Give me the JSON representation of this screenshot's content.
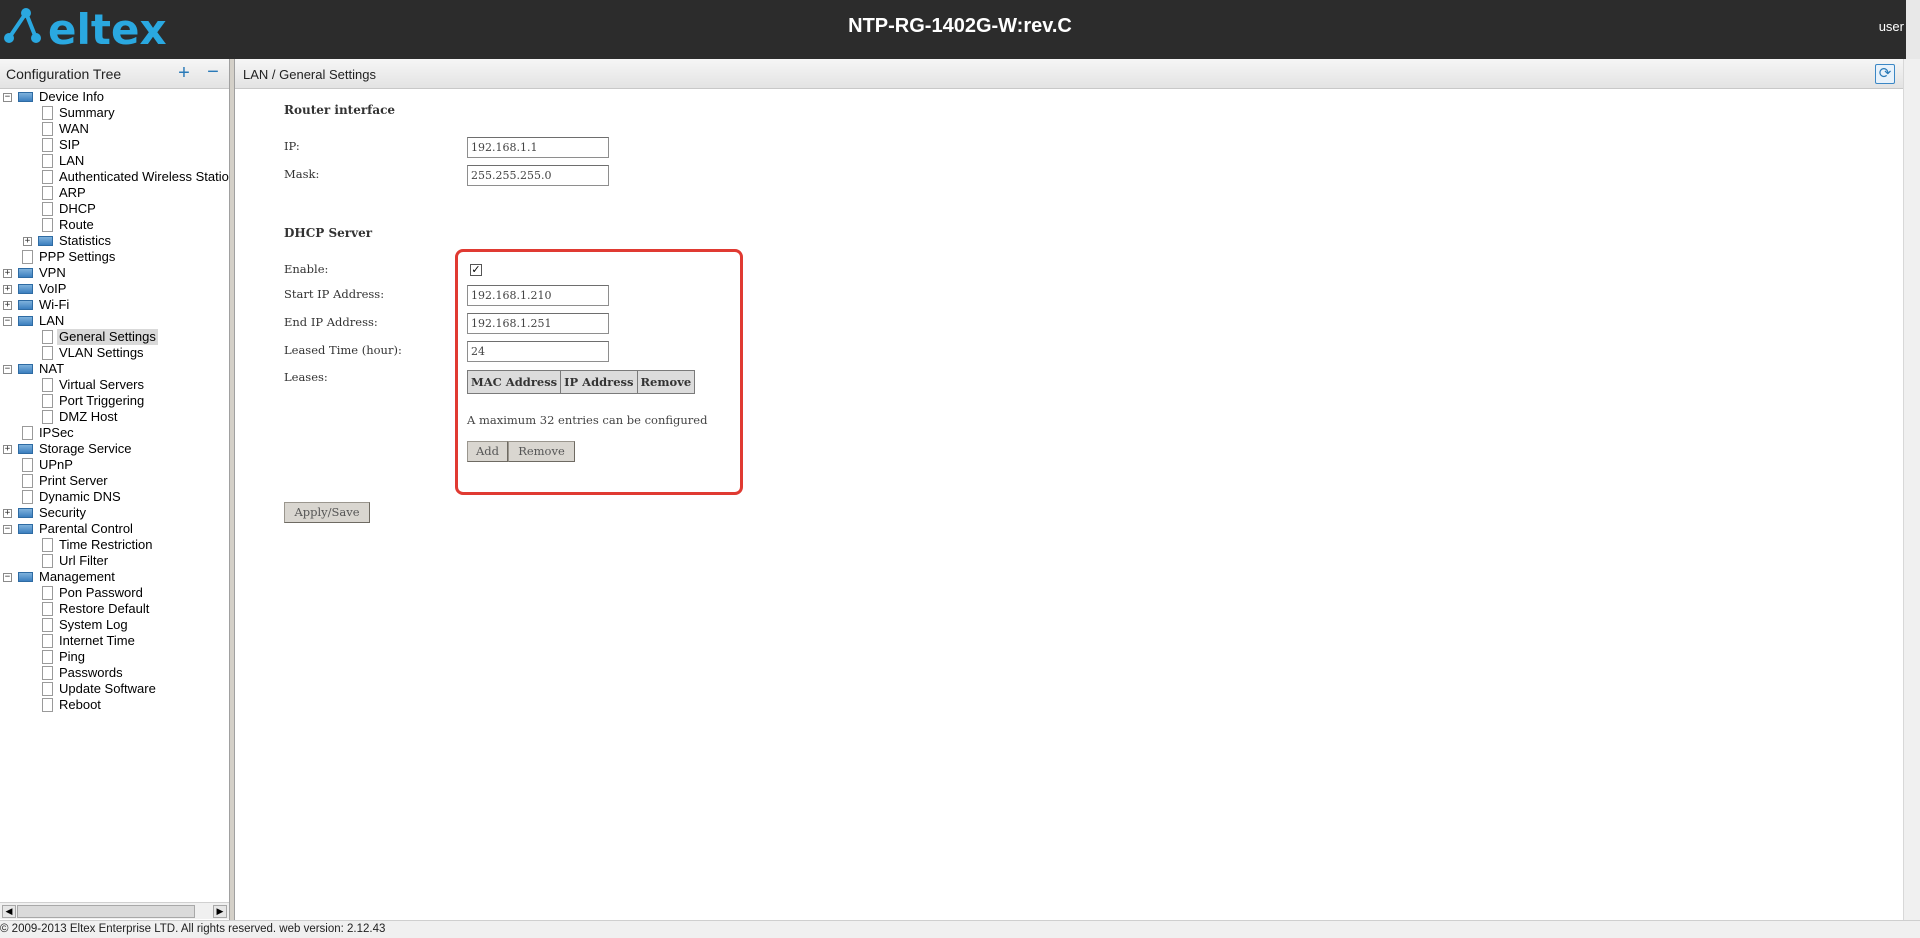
{
  "header": {
    "logo_text": "eltex",
    "device_title": "NTP-RG-1402G-W:rev.C",
    "user": "user"
  },
  "sidebar": {
    "title": "Configuration Tree",
    "tree": [
      {
        "label": "Device Info",
        "level": 0,
        "type": "folder",
        "toggle": "-"
      },
      {
        "label": "Summary",
        "level": 1,
        "type": "page"
      },
      {
        "label": "WAN",
        "level": 1,
        "type": "page"
      },
      {
        "label": "SIP",
        "level": 1,
        "type": "page"
      },
      {
        "label": "LAN",
        "level": 1,
        "type": "page"
      },
      {
        "label": "Authenticated Wireless Statio",
        "level": 1,
        "type": "page"
      },
      {
        "label": "ARP",
        "level": 1,
        "type": "page"
      },
      {
        "label": "DHCP",
        "level": 1,
        "type": "page"
      },
      {
        "label": "Route",
        "level": 1,
        "type": "page"
      },
      {
        "label": "Statistics",
        "level": 1,
        "type": "folder",
        "toggle": "+"
      },
      {
        "label": "PPP Settings",
        "level": 0,
        "type": "page"
      },
      {
        "label": "VPN",
        "level": 0,
        "type": "folder",
        "toggle": "+"
      },
      {
        "label": "VoIP",
        "level": 0,
        "type": "folder",
        "toggle": "+"
      },
      {
        "label": "Wi-Fi",
        "level": 0,
        "type": "folder",
        "toggle": "+"
      },
      {
        "label": "LAN",
        "level": 0,
        "type": "folder",
        "toggle": "-"
      },
      {
        "label": "General Settings",
        "level": 1,
        "type": "page",
        "selected": true
      },
      {
        "label": "VLAN Settings",
        "level": 1,
        "type": "page"
      },
      {
        "label": "NAT",
        "level": 0,
        "type": "folder",
        "toggle": "-"
      },
      {
        "label": "Virtual Servers",
        "level": 1,
        "type": "page"
      },
      {
        "label": "Port Triggering",
        "level": 1,
        "type": "page"
      },
      {
        "label": "DMZ Host",
        "level": 1,
        "type": "page"
      },
      {
        "label": "IPSec",
        "level": 0,
        "type": "page"
      },
      {
        "label": "Storage Service",
        "level": 0,
        "type": "folder",
        "toggle": "+"
      },
      {
        "label": "UPnP",
        "level": 0,
        "type": "page"
      },
      {
        "label": "Print Server",
        "level": 0,
        "type": "page"
      },
      {
        "label": "Dynamic DNS",
        "level": 0,
        "type": "page"
      },
      {
        "label": "Security",
        "level": 0,
        "type": "folder",
        "toggle": "+"
      },
      {
        "label": "Parental Control",
        "level": 0,
        "type": "folder",
        "toggle": "-"
      },
      {
        "label": "Time Restriction",
        "level": 1,
        "type": "page"
      },
      {
        "label": "Url Filter",
        "level": 1,
        "type": "page"
      },
      {
        "label": "Management",
        "level": 0,
        "type": "folder",
        "toggle": "-"
      },
      {
        "label": "Pon Password",
        "level": 1,
        "type": "page"
      },
      {
        "label": "Restore Default",
        "level": 1,
        "type": "page"
      },
      {
        "label": "System Log",
        "level": 1,
        "type": "page"
      },
      {
        "label": "Internet Time",
        "level": 1,
        "type": "page"
      },
      {
        "label": "Ping",
        "level": 1,
        "type": "page"
      },
      {
        "label": "Passwords",
        "level": 1,
        "type": "page"
      },
      {
        "label": "Update Software",
        "level": 1,
        "type": "page"
      },
      {
        "label": "Reboot",
        "level": 1,
        "type": "page"
      }
    ]
  },
  "main": {
    "breadcrumb": "LAN / General Settings",
    "router_interface": {
      "title": "Router interface",
      "ip_label": "IP:",
      "ip_value": "192.168.1.1",
      "mask_label": "Mask:",
      "mask_value": "255.255.255.0"
    },
    "dhcp": {
      "title": "DHCP Server",
      "enable_label": "Enable:",
      "enable_checked": true,
      "start_label": "Start IP Address:",
      "start_value": "192.168.1.210",
      "end_label": "End IP Address:",
      "end_value": "192.168.1.251",
      "lease_label": "Leased Time (hour):",
      "lease_value": "24",
      "leases_label": "Leases:",
      "leases_columns": [
        "MAC Address",
        "IP Address",
        "Remove"
      ],
      "note": "A maximum 32 entries can be configured",
      "add_label": "Add",
      "remove_label": "Remove"
    },
    "apply_label": "Apply/Save"
  },
  "footer": {
    "text": "© 2009-2013 Eltex Enterprise LTD. All rights reserved. web version: 2.12.43"
  },
  "colors": {
    "header_bg": "#2c2c2c",
    "logo": "#2aa8e0",
    "highlight": "#e03a32"
  }
}
